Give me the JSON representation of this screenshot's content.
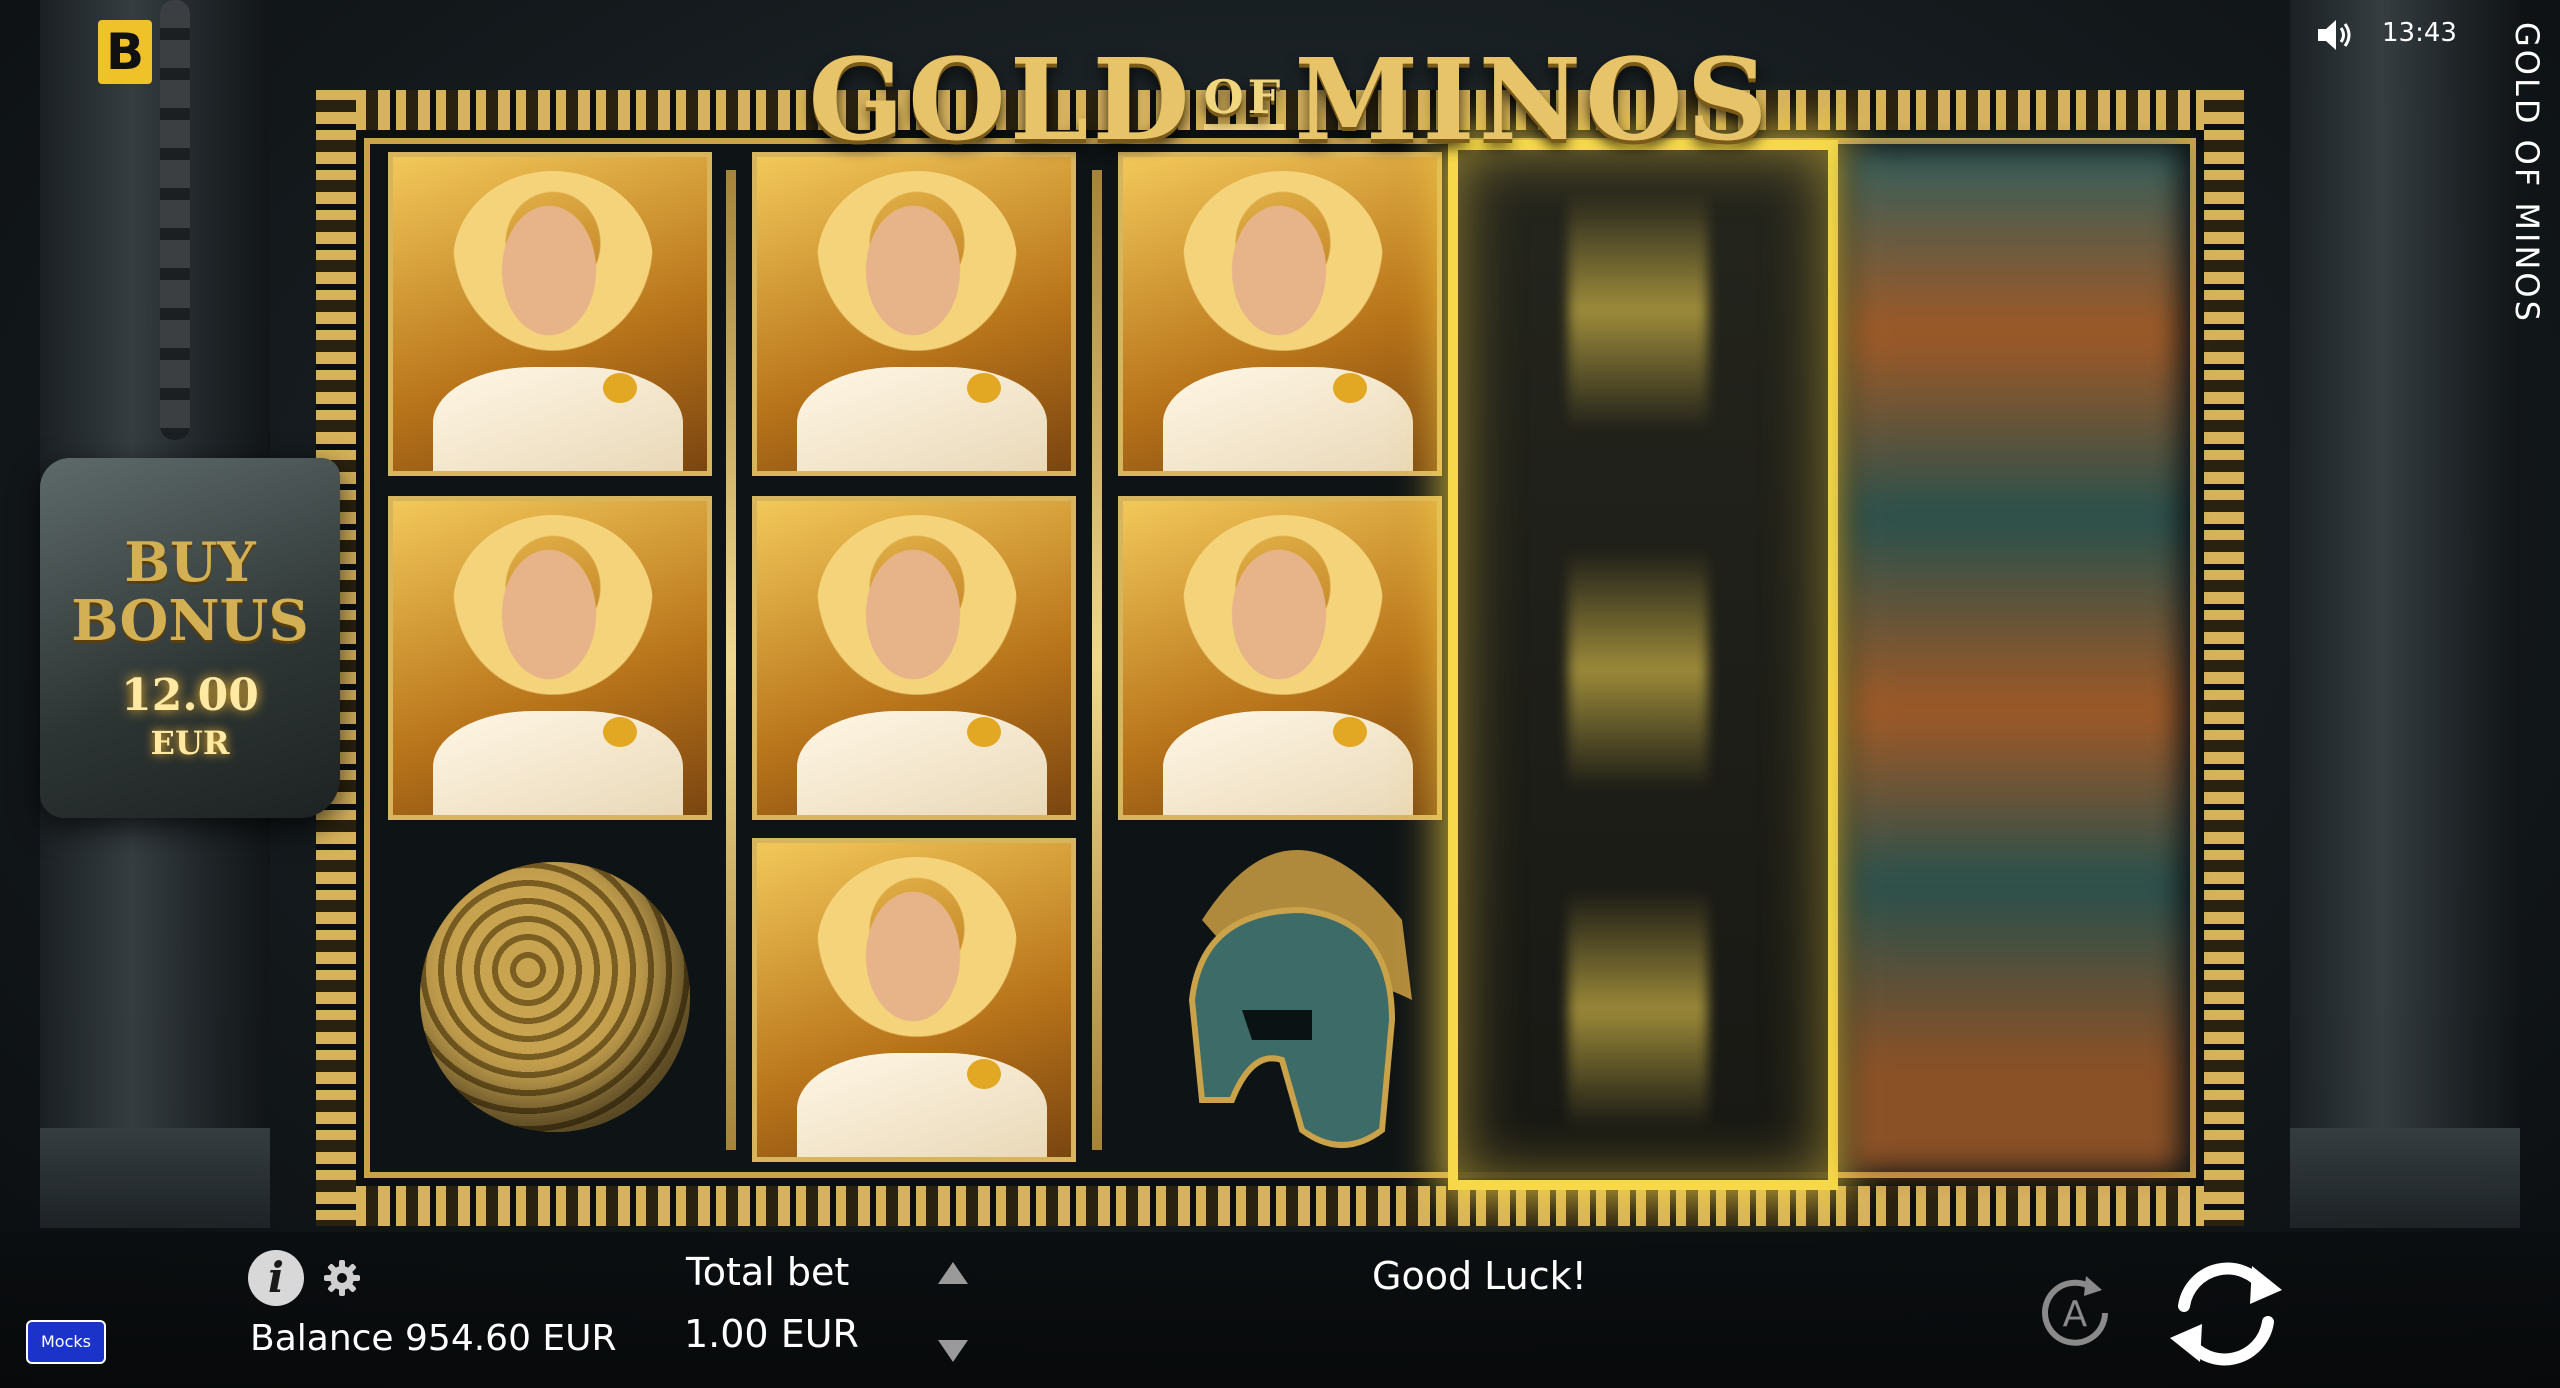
{
  "header": {
    "brand_logo": "B",
    "clock": "13:43",
    "side_title": "GOLD OF MINOS",
    "sound_icon": "speaker-icon"
  },
  "game": {
    "title_main_left": "GOLD",
    "title_of": "OF",
    "title_main_right": "MINOS",
    "buy_bonus": {
      "line1": "BUY",
      "line2": "BONUS",
      "price": "12.00",
      "currency": "EUR"
    },
    "reels": {
      "symbols": [
        [
          "hero",
          "hero",
          "yarn-ball"
        ],
        [
          "hero",
          "hero",
          "hero"
        ],
        [
          "hero",
          "hero",
          "helmet"
        ],
        [
          "spinning"
        ],
        [
          "spinning"
        ]
      ]
    }
  },
  "footer": {
    "mocks_label": "Mocks",
    "info_label": "i",
    "balance": "Balance 954.60 EUR",
    "total_bet_label": "Total bet",
    "total_bet_value": "1.00 EUR",
    "message": "Good Luck!",
    "autoplay_label": "A"
  }
}
